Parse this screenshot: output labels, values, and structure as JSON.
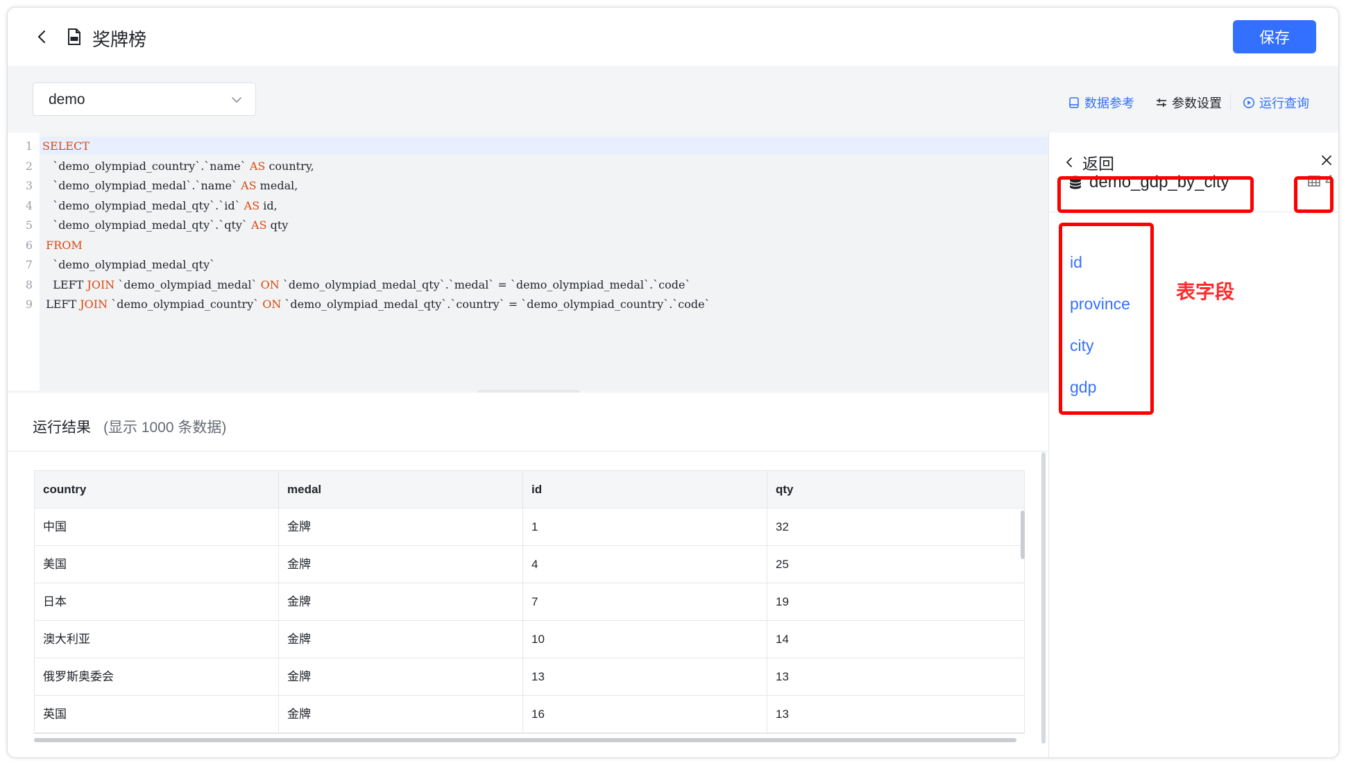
{
  "header": {
    "title": "奖牌榜",
    "save_label": "保存"
  },
  "datasource": {
    "selected": "demo"
  },
  "toolbar": {
    "data_ref_label": "数据参考",
    "params_label": "参数设置",
    "run_label": "运行查询"
  },
  "editor": {
    "lines": [
      {
        "n": "1",
        "t": "SELECT"
      },
      {
        "n": "2",
        "t": "   `demo_olympiad_country`.`name` AS country,"
      },
      {
        "n": "3",
        "t": "   `demo_olympiad_medal`.`name` AS medal,"
      },
      {
        "n": "4",
        "t": "   `demo_olympiad_medal_qty`.`id` AS id,"
      },
      {
        "n": "5",
        "t": "   `demo_olympiad_medal_qty`.`qty` AS qty"
      },
      {
        "n": "6",
        "t": " FROM"
      },
      {
        "n": "7",
        "t": "   `demo_olympiad_medal_qty`"
      },
      {
        "n": "8",
        "t": "   LEFT JOIN `demo_olympiad_medal` ON `demo_olympiad_medal_qty`.`medal` = `demo_olympiad_medal`.`code`"
      },
      {
        "n": "9",
        "t": " LEFT JOIN `demo_olympiad_country` ON `demo_olympiad_medal_qty`.`country` = `demo_olympiad_country`.`code`"
      }
    ]
  },
  "results": {
    "title": "运行结果",
    "note": "(显示 1000 条数据)",
    "columns": [
      "country",
      "medal",
      "id",
      "qty"
    ],
    "rows": [
      [
        "中国",
        "金牌",
        "1",
        "32"
      ],
      [
        "美国",
        "金牌",
        "4",
        "25"
      ],
      [
        "日本",
        "金牌",
        "7",
        "19"
      ],
      [
        "澳大利亚",
        "金牌",
        "10",
        "14"
      ],
      [
        "俄罗斯奥委会",
        "金牌",
        "13",
        "13"
      ],
      [
        "英国",
        "金牌",
        "16",
        "13"
      ]
    ]
  },
  "panel": {
    "back_label": "返回",
    "table_name": "demo_gdp_by_city",
    "field_count": "4",
    "fields": [
      "id",
      "province",
      "city",
      "gdp"
    ],
    "annotation": "表字段"
  },
  "colors": {
    "accent": "#3370ff",
    "annotation": "#ff0000"
  }
}
